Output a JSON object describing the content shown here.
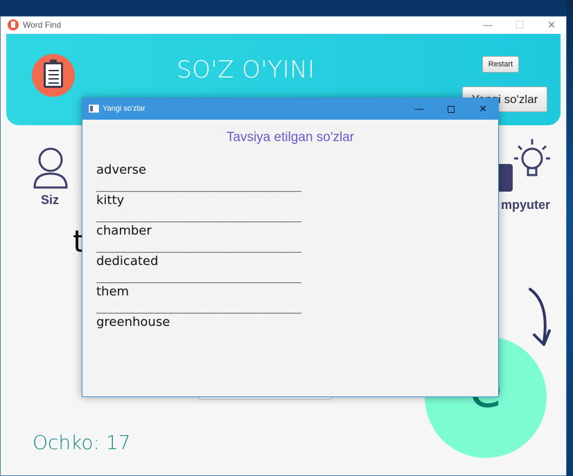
{
  "main_window": {
    "title": "Word Find",
    "controls": {
      "minimize": "—",
      "maximize": "☐",
      "close": "✕"
    }
  },
  "header": {
    "title": "SO'Z O'YINI",
    "restart_label": "Restart",
    "new_words_label": "Yangi so'zlar",
    "logo_icon": "clipboard-icon",
    "band_color": "#22d0e0"
  },
  "players": {
    "user_label": "Siz",
    "user_icon": "user-icon",
    "computer_label": "mpyuter",
    "computer_icon": "robot-lightbulb-icon"
  },
  "game": {
    "current_letter": "t",
    "circle_letter": "e",
    "circle_color": "#7dfcd4",
    "arrow_icon": "curved-arrow-icon"
  },
  "score": {
    "text": "Ochko: 17"
  },
  "dialog": {
    "title": "Yangi so'zlar",
    "heading": "Tavsiya etilgan so'zlar",
    "heading_color": "#6a59c9",
    "controls": {
      "minimize": "—",
      "close": "✕"
    },
    "separator": "______________________________",
    "words": [
      "adverse",
      "kitty",
      "chamber",
      "dedicated",
      "them",
      "greenhouse"
    ]
  }
}
